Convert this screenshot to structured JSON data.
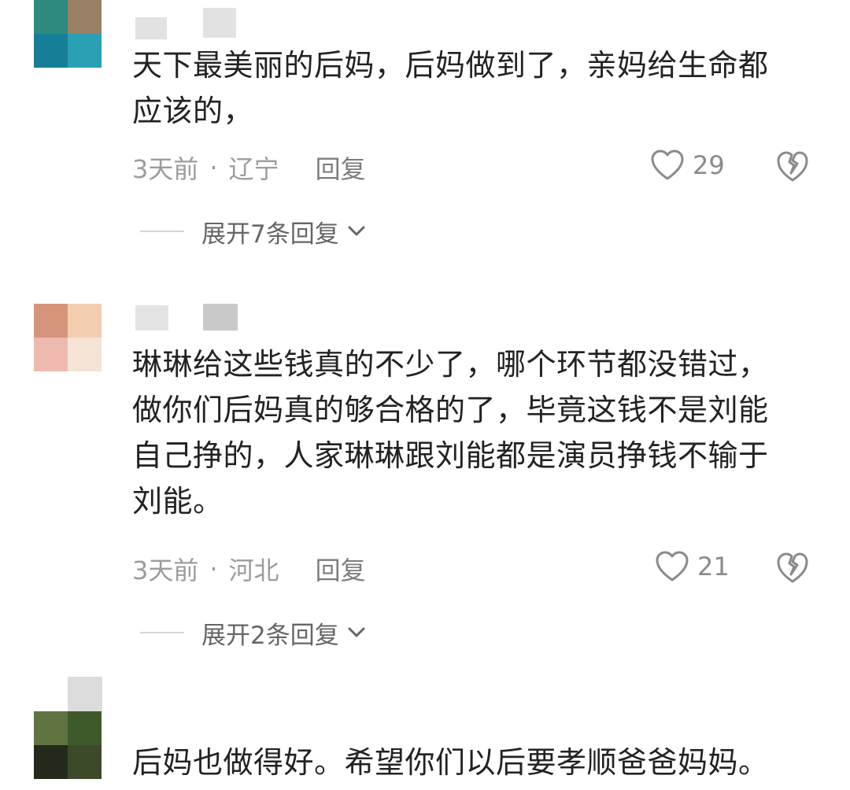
{
  "comments": [
    {
      "text_lines": [
        "天下最美丽的后妈，后妈做到了，亲妈给生命都",
        "应该的，"
      ],
      "time": "3天前",
      "location": "辽宁",
      "reply_label": "回复",
      "likes": "29",
      "expand_label": "展开7条回复",
      "avatar_colors": [
        "#2e8a7f",
        "#9a8065",
        "#167e96",
        "#2aa0b4"
      ]
    },
    {
      "text_lines": [
        "琳琳给这些钱真的不少了，哪个环节都没错过，",
        "做你们后妈真的够合格的了，毕竟这钱不是刘能",
        "自己挣的，人家琳琳跟刘能都是演员挣钱不输于",
        "刘能。"
      ],
      "time": "3天前",
      "location": "河北",
      "reply_label": "回复",
      "likes": "21",
      "expand_label": "展开2条回复",
      "avatar_colors": [
        "#d6957a",
        "#f2cdb0",
        "#eebab0",
        "#f4e4d6"
      ]
    },
    {
      "text_lines": [
        "后妈也做得好。希望你们以后要孝顺爸爸妈妈。"
      ],
      "avatar_colors": [
        "#5f7440",
        "#3f5a2a",
        "#23291b",
        "#3d4a2a"
      ]
    }
  ],
  "colors": {
    "text": "#222222",
    "meta": "#9c9c9c",
    "icon": "#8a8a8a"
  },
  "icons": {
    "like": "heart-outline-icon",
    "dislike": "broken-heart-icon",
    "expand": "chevron-down-icon"
  }
}
